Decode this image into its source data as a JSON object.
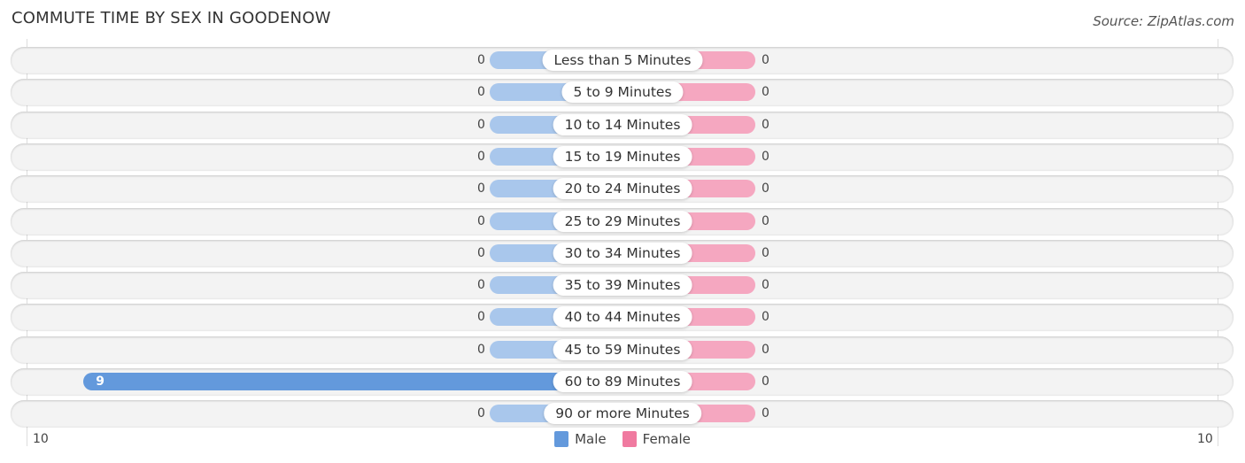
{
  "header": {
    "title": "COMMUTE TIME BY SEX IN GOODENOW",
    "source": "Source: ZipAtlas.com"
  },
  "colors": {
    "male": "#6399dc",
    "male_light": "#a9c7ec",
    "female": "#f07aa0",
    "female_light": "#f5a7c0"
  },
  "chart_data": {
    "type": "bar",
    "orientation": "horizontal-diverging",
    "title": "COMMUTE TIME BY SEX IN GOODENOW",
    "categories": [
      "Less than 5 Minutes",
      "5 to 9 Minutes",
      "10 to 14 Minutes",
      "15 to 19 Minutes",
      "20 to 24 Minutes",
      "25 to 29 Minutes",
      "30 to 34 Minutes",
      "35 to 39 Minutes",
      "40 to 44 Minutes",
      "45 to 59 Minutes",
      "60 to 89 Minutes",
      "90 or more Minutes"
    ],
    "series": [
      {
        "name": "Male",
        "values": [
          0,
          0,
          0,
          0,
          0,
          0,
          0,
          0,
          0,
          0,
          9,
          0
        ]
      },
      {
        "name": "Female",
        "values": [
          0,
          0,
          0,
          0,
          0,
          0,
          0,
          0,
          0,
          0,
          0,
          0
        ]
      }
    ],
    "axis": {
      "left_label": "10",
      "right_label": "10",
      "max": 10
    },
    "legend": {
      "position": "bottom-center",
      "entries": [
        "Male",
        "Female"
      ]
    },
    "grid": false
  }
}
